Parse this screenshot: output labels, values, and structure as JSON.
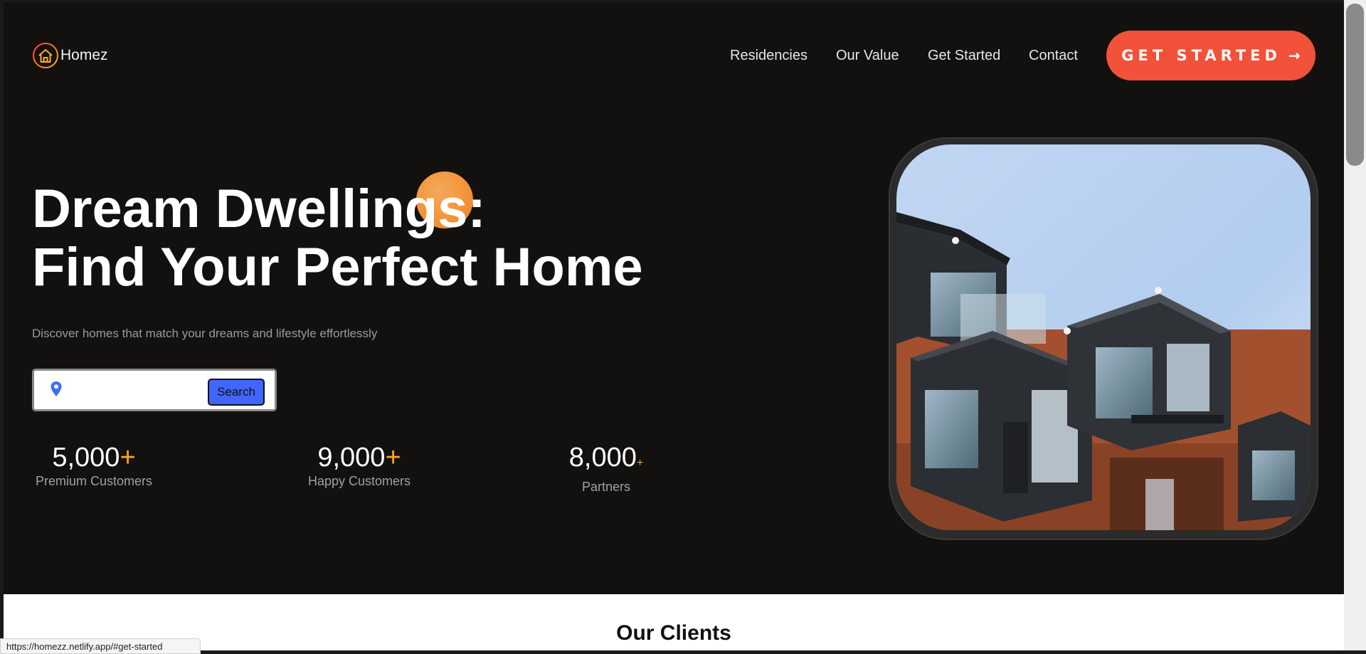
{
  "header": {
    "logo_text": "Homez",
    "nav": [
      "Residencies",
      "Our Value",
      "Get Started",
      "Contact"
    ],
    "cta_label": "GET STARTED",
    "cta_arrow": "→"
  },
  "hero": {
    "title_line1": "Dream Dwellings:",
    "title_line2": "Find Your Perfect Home",
    "subtitle": "Discover homes that match your dreams and lifestyle effortlessly",
    "search": {
      "icon": "location-pin-icon",
      "value": "",
      "button_label": "Search"
    },
    "stats": [
      {
        "value": "5,000",
        "plus": "+",
        "label": "Premium Customers"
      },
      {
        "value": "9,000",
        "plus": "+",
        "label": "Happy Customers"
      },
      {
        "value": "8,000",
        "plus": "+",
        "label": "Partners"
      }
    ],
    "image": "modern-apartment-building-photo"
  },
  "clients": {
    "title": "Our Clients"
  },
  "status_bar": {
    "url": "https://homezz.netlify.app/#get-started"
  },
  "colors": {
    "background": "#131110",
    "accent_orange": "#f5a623",
    "cta": "#f2513a",
    "search_button": "#4066ff"
  }
}
